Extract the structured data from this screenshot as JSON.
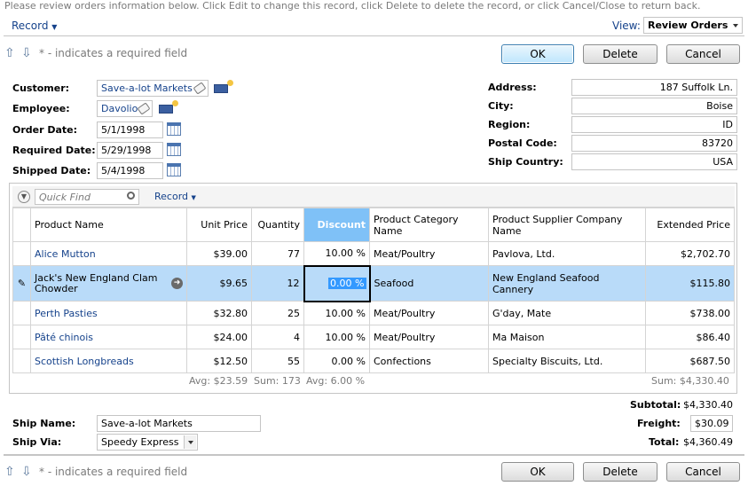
{
  "top_message": "Please review orders information below. Click Edit to change this record, click Delete to delete the record, or click Cancel/Close to return back.",
  "record_menu": "Record",
  "view": {
    "label": "View:",
    "value": "Review Orders"
  },
  "required_note": "* - indicates a required field",
  "buttons": {
    "ok": "OK",
    "delete": "Delete",
    "cancel": "Cancel"
  },
  "form": {
    "customer": {
      "label": "Customer:",
      "value": "Save-a-lot Markets"
    },
    "employee": {
      "label": "Employee:",
      "value": "Davolio"
    },
    "order_date": {
      "label": "Order Date:",
      "value": "5/1/1998"
    },
    "required_date": {
      "label": "Required Date:",
      "value": "5/29/1998"
    },
    "shipped_date": {
      "label": "Shipped Date:",
      "value": "5/4/1998"
    },
    "address": {
      "label": "Address:",
      "value": "187 Suffolk Ln."
    },
    "city": {
      "label": "City:",
      "value": "Boise"
    },
    "region": {
      "label": "Region:",
      "value": "ID"
    },
    "postal_code": {
      "label": "Postal Code:",
      "value": "83720"
    },
    "ship_country": {
      "label": "Ship Country:",
      "value": "USA"
    }
  },
  "grid": {
    "quick_find_placeholder": "Quick Find",
    "record_menu": "Record",
    "columns": [
      "Product Name",
      "Unit Price",
      "Quantity",
      "Discount",
      "Product Category Name",
      "Product Supplier Company Name",
      "Extended Price"
    ],
    "rows": [
      {
        "product": "Alice Mutton",
        "unit_price": "$39.00",
        "quantity": "77",
        "discount": "10.00 %",
        "category": "Meat/Poultry",
        "supplier": "Pavlova, Ltd.",
        "extended": "$2,702.70"
      },
      {
        "product": "Jack's New England Clam Chowder",
        "unit_price": "$9.65",
        "quantity": "12",
        "discount": "0.00 %",
        "category": "Seafood",
        "supplier": "New England Seafood Cannery",
        "extended": "$115.80"
      },
      {
        "product": "Perth Pasties",
        "unit_price": "$32.80",
        "quantity": "25",
        "discount": "10.00 %",
        "category": "Meat/Poultry",
        "supplier": "G'day, Mate",
        "extended": "$738.00"
      },
      {
        "product": "Pâté chinois",
        "unit_price": "$24.00",
        "quantity": "4",
        "discount": "10.00 %",
        "category": "Meat/Poultry",
        "supplier": "Ma Maison",
        "extended": "$86.40"
      },
      {
        "product": "Scottish Longbreads",
        "unit_price": "$12.50",
        "quantity": "55",
        "discount": "0.00 %",
        "category": "Confections",
        "supplier": "Specialty Biscuits, Ltd.",
        "extended": "$687.50"
      }
    ],
    "footer": {
      "avg_price": "Avg: $23.59",
      "sum_qty": "Sum: 173",
      "avg_discount": "Avg: 6.00 %",
      "sum_extended": "Sum: $4,330.40"
    }
  },
  "totals": {
    "subtotal": {
      "label": "Subtotal:",
      "value": "$4,330.40"
    },
    "freight": {
      "label": "Freight:",
      "value": "$30.09"
    },
    "total": {
      "label": "Total:",
      "value": "$4,360.49"
    }
  },
  "ship": {
    "name": {
      "label": "Ship Name:",
      "value": "Save-a-lot Markets"
    },
    "via": {
      "label": "Ship Via:",
      "value": "Speedy Express"
    }
  },
  "colors": {
    "link": "#15428b",
    "selection": "#b9dbf9",
    "header_highlight": "#7fc1f7"
  }
}
